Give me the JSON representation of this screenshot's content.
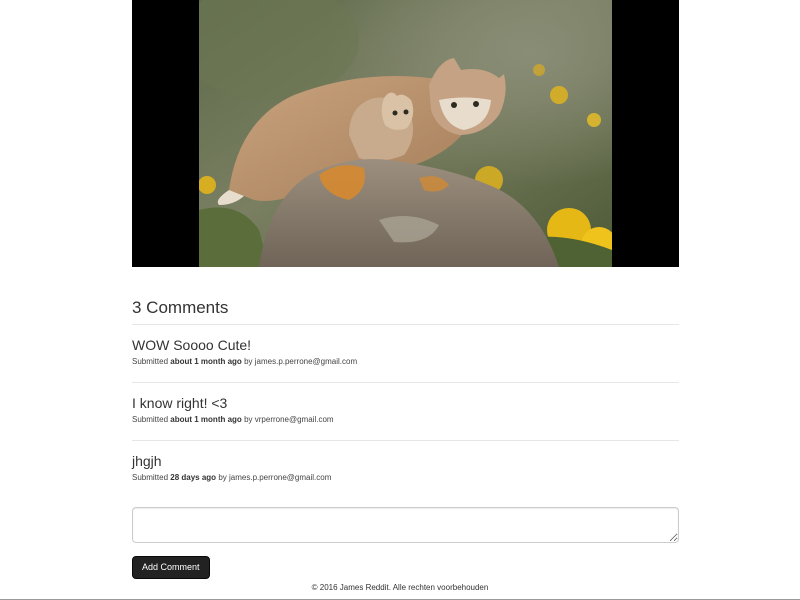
{
  "post": {
    "image_subject": "bobcat-with-kitten-photo"
  },
  "comments": {
    "heading": "3 Comments",
    "items": [
      {
        "text": "WOW Soooo Cute!",
        "submitted_label": "Submitted",
        "time": "about 1 month ago",
        "by_label": "by",
        "author": "james.p.perrone@gmail.com"
      },
      {
        "text": "I know right! <3",
        "submitted_label": "Submitted",
        "time": "about 1 month ago",
        "by_label": "by",
        "author": "vrperrone@gmail.com"
      },
      {
        "text": "jhgjh",
        "submitted_label": "Submitted",
        "time": "28 days ago",
        "by_label": "by",
        "author": "james.p.perrone@gmail.com"
      }
    ]
  },
  "form": {
    "comment_value": "",
    "comment_placeholder": "",
    "submit_label": "Add Comment"
  },
  "footer": {
    "text": "© 2016 James Reddit. Alle rechten voorbehouden"
  },
  "colors": {
    "button_bg": "#222222",
    "divider": "#e6e6e6",
    "media_bg": "#000000"
  }
}
